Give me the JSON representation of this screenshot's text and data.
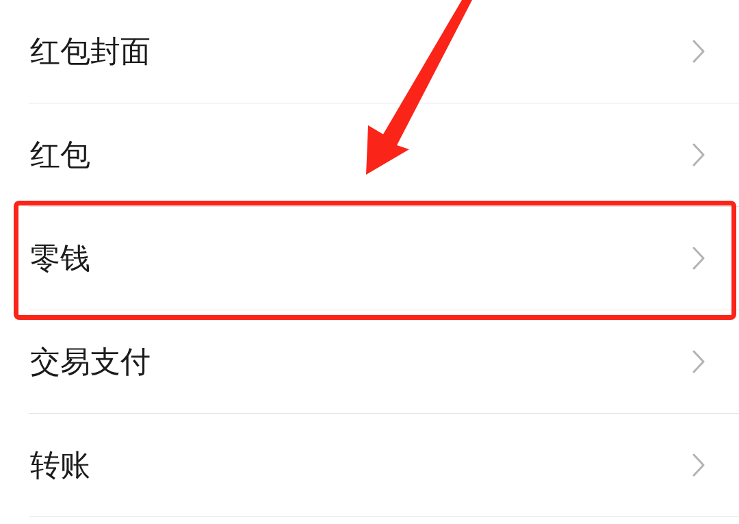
{
  "items": [
    {
      "label": "红包封面",
      "highlighted": false
    },
    {
      "label": "红包",
      "highlighted": false
    },
    {
      "label": "零钱",
      "highlighted": true
    },
    {
      "label": "交易支付",
      "highlighted": false
    },
    {
      "label": "转账",
      "highlighted": false
    }
  ]
}
